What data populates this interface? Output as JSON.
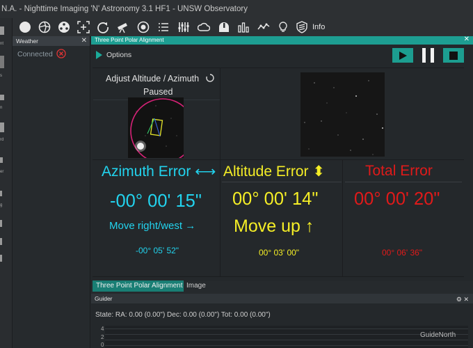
{
  "window": {
    "title": "N.A. - Nighttime Imaging 'N' Astronomy 3.1 HF1  -  UNSW Observatory"
  },
  "left_strip": {
    "labels": [
      "nt",
      "s",
      "n",
      "rd",
      "er",
      "g"
    ]
  },
  "toolbar": {
    "icons": [
      "camera-icon",
      "filter-wheel-icon",
      "focuser-icon",
      "framing-icon",
      "rotator-icon",
      "telescope-icon",
      "guider-icon",
      "sequencer-icon",
      "equipment-icon",
      "weather-icon",
      "dome-icon",
      "statistics-icon",
      "graph-icon",
      "flat-panel-icon",
      "safety-icon"
    ],
    "info_label": "Info"
  },
  "weather": {
    "title": "Weather",
    "close": "✕",
    "status": "Connected"
  },
  "polar_alignment": {
    "title": "Three Point Polar Alignment",
    "close": "✕",
    "options_label": "Options",
    "adjust_label": "Adjust Altitude / Azimuth",
    "status": "Paused",
    "azimuth": {
      "title": "Azimuth Error ⟷",
      "value": "-00° 00' 15\"",
      "move": "Move right/west →",
      "total": "-00° 05' 52\""
    },
    "altitude": {
      "title": "Altitude Error ⬍",
      "value": "00° 00' 14\"",
      "move": "Move up ↑",
      "total": "00° 03' 00\""
    },
    "total": {
      "title": "Total Error",
      "value": "00° 00' 20\"",
      "total": "00° 06' 36\""
    }
  },
  "tabs": {
    "active": "Three Point Polar Alignment",
    "other": "Image"
  },
  "guider": {
    "title": "Guider",
    "state": "State:   RA: 0.00 (0.00\")  Dec: 0.00 (0.00\")  Tot: 0.00 (0.00\")",
    "y_labels": [
      "4",
      "2",
      "0"
    ],
    "direction": "GuideNorth"
  },
  "colors": {
    "accent": "#1d9e92",
    "azimuth": "#22d3ee",
    "altitude": "#f5ee26",
    "total": "#e01a1a"
  }
}
